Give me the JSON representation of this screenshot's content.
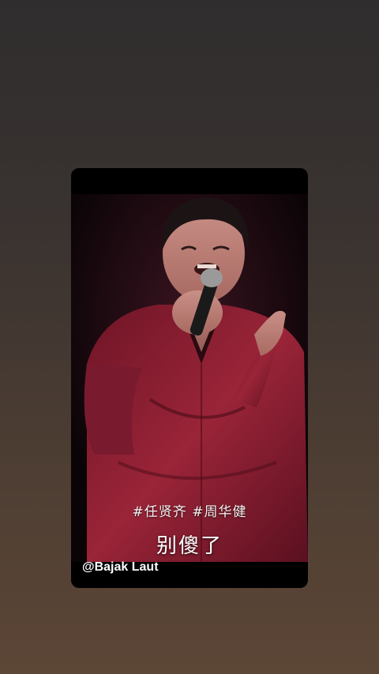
{
  "video": {
    "hashtags": "#任贤齐 #周华健",
    "caption": "别傻了",
    "watermark": "@Bajak Laut"
  },
  "colors": {
    "shirt": "#8a1f32",
    "background_top": "#2f2d2e",
    "background_bottom": "#5c4636"
  }
}
